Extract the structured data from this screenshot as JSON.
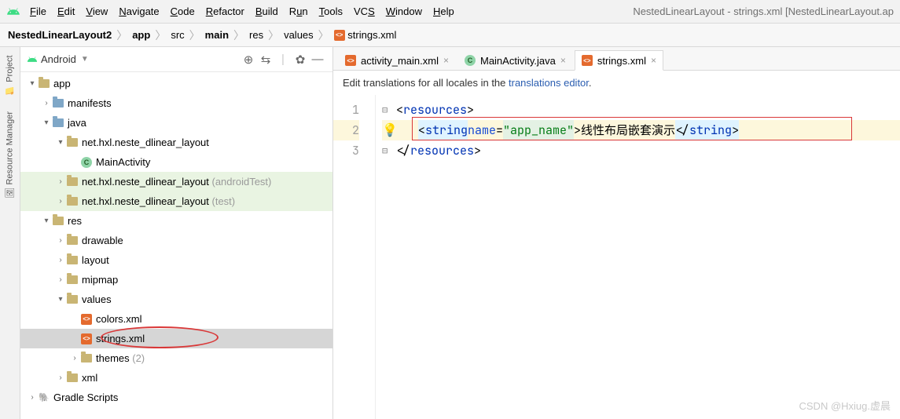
{
  "menubar": {
    "items": [
      "File",
      "Edit",
      "View",
      "Navigate",
      "Code",
      "Refactor",
      "Build",
      "Run",
      "Tools",
      "VCS",
      "Window",
      "Help"
    ],
    "title": "NestedLinearLayout - strings.xml [NestedLinearLayout.ap"
  },
  "breadcrumb": {
    "items": [
      "NestedLinearLayout2",
      "app",
      "src",
      "main",
      "res",
      "values",
      "strings.xml"
    ]
  },
  "rail": {
    "project": "Project",
    "resmgr": "Resource Manager"
  },
  "sidetool": {
    "selector": "Android"
  },
  "tree": {
    "app": "app",
    "manifests": "manifests",
    "java": "java",
    "pkg": "net.hxl.neste_dlinear_layout",
    "main_activity": "MainActivity",
    "pkg_at": "net.hxl.neste_dlinear_layout",
    "pkg_at_suffix": " (androidTest)",
    "pkg_t": "net.hxl.neste_dlinear_layout",
    "pkg_t_suffix": " (test)",
    "res": "res",
    "drawable": "drawable",
    "layout": "layout",
    "mipmap": "mipmap",
    "values": "values",
    "colors": "colors.xml",
    "strings": "strings.xml",
    "themes": "themes",
    "themes_suffix": " (2)",
    "xml": "xml",
    "gradle": "Gradle Scripts"
  },
  "tabs": {
    "t1": "activity_main.xml",
    "t2": "MainActivity.java",
    "t3": "strings.xml"
  },
  "banner": {
    "text": "Edit translations for all locales in the ",
    "link": "translations editor",
    "after": "."
  },
  "code": {
    "l1_a": "<",
    "l1_b": "resources",
    "l1_c": ">",
    "l2_a": "<",
    "l2_b": "string",
    "l2_sp": " ",
    "l2_c": "name",
    "l2_d": "=",
    "l2_e": "\"app_name\"",
    "l2_f": ">",
    "l2_g": "线性布局嵌套演示",
    "l2_h": "</",
    "l2_i": "string",
    "l2_j": ">",
    "l3_a": "</",
    "l3_b": "resources",
    "l3_c": ">",
    "n1": "1",
    "n2": "2",
    "n3": "3"
  },
  "watermark": "CSDN @Hxiug.虚晨"
}
